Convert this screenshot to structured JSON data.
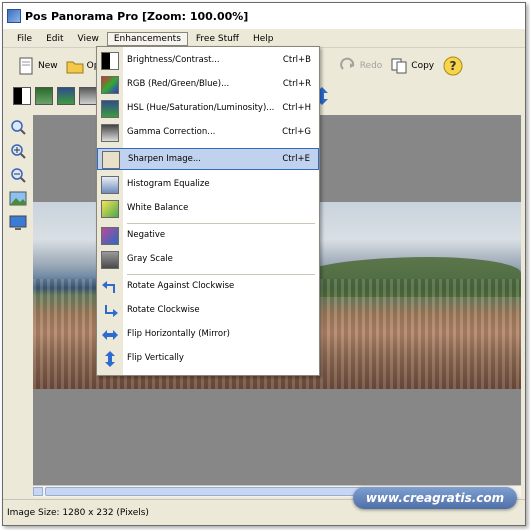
{
  "window": {
    "title": "Pos Panorama Pro [Zoom: 100.00%]"
  },
  "menubar": {
    "items": [
      {
        "label": "File"
      },
      {
        "label": "Edit"
      },
      {
        "label": "View"
      },
      {
        "label": "Enhancements"
      },
      {
        "label": "Free Stuff"
      },
      {
        "label": "Help"
      }
    ]
  },
  "toolbar": {
    "new_label": "New",
    "open_label": "Open",
    "redo_label": "Redo",
    "copy_label": "Copy"
  },
  "enhancements_menu": {
    "items": [
      {
        "label": "Brightness/Contrast...",
        "shortcut": "Ctrl+B",
        "icon": "brightness-contrast-icon"
      },
      {
        "label": "RGB (Red/Green/Blue)...",
        "shortcut": "Ctrl+R",
        "icon": "rgb-icon"
      },
      {
        "label": "HSL (Hue/Saturation/Luminosity)...",
        "shortcut": "Ctrl+H",
        "icon": "hsl-icon"
      },
      {
        "label": "Gamma Correction...",
        "shortcut": "Ctrl+G",
        "icon": "gamma-icon"
      },
      {
        "label": "Sharpen Image...",
        "shortcut": "Ctrl+E",
        "icon": "sharpen-icon"
      },
      {
        "label": "Histogram Equalize",
        "shortcut": "",
        "icon": "histogram-icon"
      },
      {
        "label": "White Balance",
        "shortcut": "",
        "icon": "white-balance-icon"
      },
      {
        "label": "Negative",
        "shortcut": "",
        "icon": "negative-icon"
      },
      {
        "label": "Gray Scale",
        "shortcut": "",
        "icon": "gray-scale-icon"
      },
      {
        "label": "Rotate Against Clockwise",
        "shortcut": "",
        "icon": "rotate-ccw-icon"
      },
      {
        "label": "Rotate Clockwise",
        "shortcut": "",
        "icon": "rotate-cw-icon"
      },
      {
        "label": "Flip Horizontally (Mirror)",
        "shortcut": "",
        "icon": "flip-horizontal-icon"
      },
      {
        "label": "Flip Vertically",
        "shortcut": "",
        "icon": "flip-vertical-icon"
      }
    ],
    "selected_index": 4
  },
  "statusbar": {
    "text": "Image Size: 1280 x 232 (Pixels)"
  },
  "watermark": {
    "text": "www.creagratis.com"
  },
  "colors": {
    "menu_highlight": "#c1d2ee",
    "menu_highlight_border": "#316ac5",
    "chrome": "#ece9d8",
    "canvas": "#878787"
  }
}
